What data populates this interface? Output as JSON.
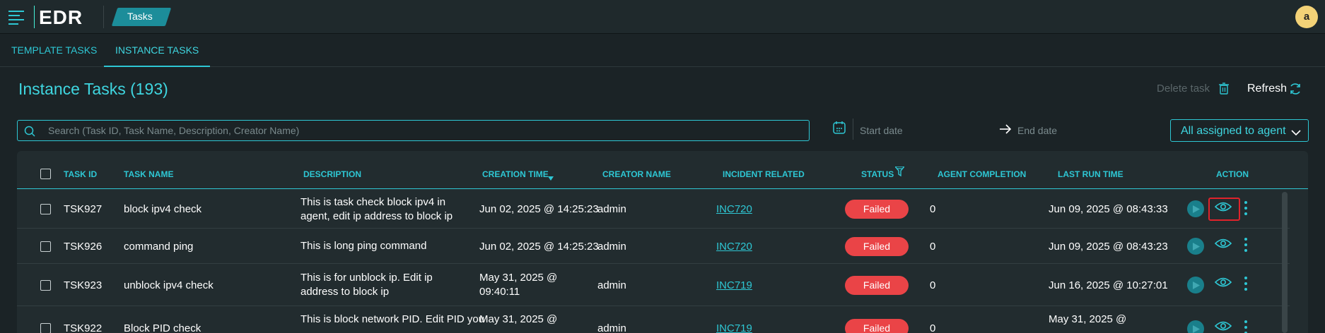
{
  "app": {
    "logo": "EDR",
    "breadcrumb": "Tasks",
    "avatar_initial": "a"
  },
  "tabs": [
    {
      "label": "TEMPLATE TASKS",
      "active": false
    },
    {
      "label": "INSTANCE TASKS",
      "active": true
    }
  ],
  "page": {
    "title": "Instance Tasks (193)",
    "delete_label": "Delete task",
    "refresh_label": "Refresh"
  },
  "filters": {
    "search_placeholder": "Search (Task ID, Task Name, Description, Creator Name)",
    "start_date_placeholder": "Start date",
    "end_date_placeholder": "End date",
    "agent_filter": "All assigned to agent"
  },
  "table": {
    "headers": {
      "task_id": "TASK ID",
      "task_name": "TASK NAME",
      "description": "DESCRIPTION",
      "creation_time": "CREATION TIME",
      "creator_name": "CREATOR NAME",
      "incident_related": "INCIDENT RELATED",
      "status": "STATUS",
      "agent_completion": "AGENT COMPLETION",
      "last_run_time": "LAST RUN TIME",
      "action": "ACTION"
    },
    "rows": [
      {
        "task_id": "TSK927",
        "task_name": "block ipv4 check",
        "description": "This is task check block ipv4 in agent, edit ip address to block ip",
        "creation_time": "Jun 02, 2025 @ 14:25:23",
        "creator_name": "admin",
        "incident": "INC720",
        "status": "Failed",
        "agent_completion": "0",
        "last_run_time": "Jun 09, 2025 @ 08:43:33"
      },
      {
        "task_id": "TSK926",
        "task_name": "command ping",
        "description": "This is long ping command",
        "creation_time": "Jun 02, 2025 @ 14:25:23",
        "creator_name": "admin",
        "incident": "INC720",
        "status": "Failed",
        "agent_completion": "0",
        "last_run_time": "Jun 09, 2025 @ 08:43:23"
      },
      {
        "task_id": "TSK923",
        "task_name": "unblock ipv4 check",
        "description": "This is for unblock ip. Edit ip address to block ip",
        "creation_time": "May 31, 2025 @ 09:40:11",
        "creator_name": "admin",
        "incident": "INC719",
        "status": "Failed",
        "agent_completion": "0",
        "last_run_time": "Jun 16, 2025 @ 10:27:01"
      },
      {
        "task_id": "TSK922",
        "task_name": "Block PID check",
        "description": "This is block network PID. Edit PID you",
        "creation_time": "May 31, 2025 @",
        "creator_name": "admin",
        "incident": "INC719",
        "status": "Failed",
        "agent_completion": "0",
        "last_run_time": "May 31, 2025 @"
      }
    ]
  },
  "colors": {
    "accent": "#2ec7d4",
    "failed": "#ea4447",
    "background": "#1b2326",
    "panel": "#222c2f"
  },
  "icons": [
    "menu-icon",
    "delete-icon",
    "refresh-icon",
    "search-icon",
    "calendar-icon",
    "arrow-right-icon",
    "chevron-down-icon",
    "filter-icon",
    "sort-down-icon",
    "play-icon",
    "eye-icon",
    "more-vertical-icon"
  ]
}
